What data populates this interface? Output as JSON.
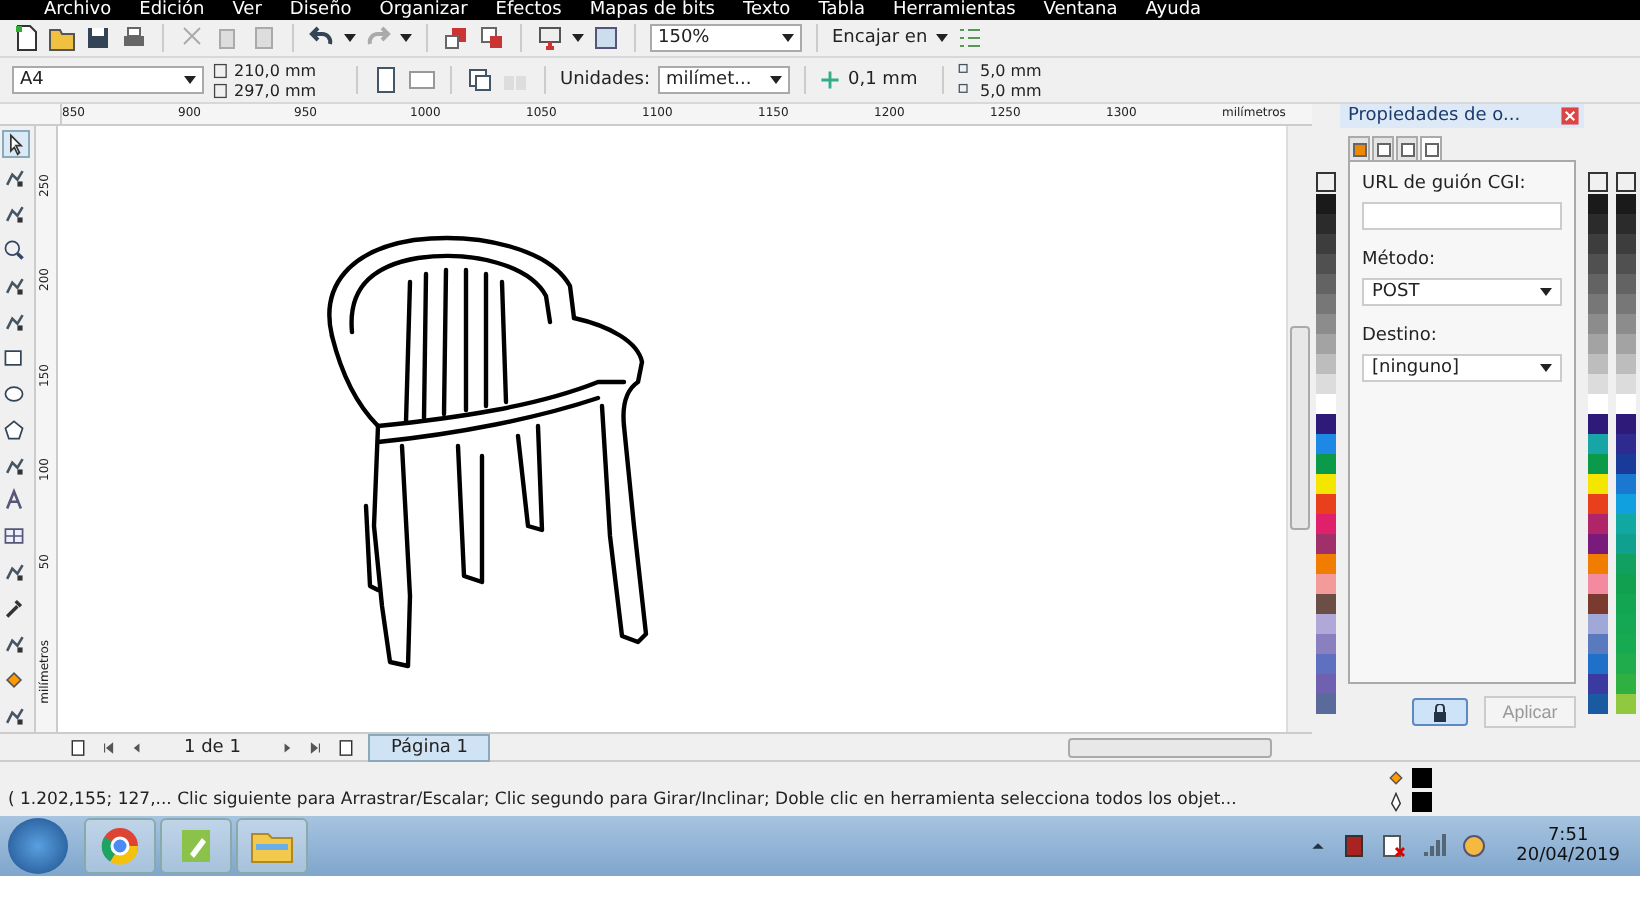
{
  "menu_bar": [
    "Archivo",
    "Edición",
    "Ver",
    "Diseño",
    "Organizar",
    "Efectos",
    "Mapas de bits",
    "Texto",
    "Tabla",
    "Herramientas",
    "Ventana",
    "Ayuda"
  ],
  "standard_toolbar": {
    "zoom": "150%",
    "snap": "Encajar en"
  },
  "property_bar": {
    "page_size": "A4",
    "width": "210,0 mm",
    "height": "297,0 mm",
    "units_label": "Unidades:",
    "units": "milímet...",
    "nudge": "0,1 mm",
    "duplicate_x": "5,0 mm",
    "duplicate_y": "5,0 mm"
  },
  "horizontal_ruler": {
    "ticks": [
      "850",
      "900",
      "950",
      "1000",
      "1050",
      "1100",
      "1150",
      "1200",
      "1250",
      "1300"
    ],
    "unit": "milímetros"
  },
  "vertical_ruler": {
    "ticks": [
      "250",
      "200",
      "150",
      "100",
      "50"
    ],
    "unit": "milímetros"
  },
  "page_navigator": {
    "count": "1 de 1",
    "tabs": [
      {
        "label": "Página 1",
        "selected": true
      }
    ]
  },
  "docker": {
    "title": "Propiedades de o...",
    "tabs": [
      {
        "selected": false
      },
      {
        "selected": false
      },
      {
        "selected": false
      },
      {
        "selected": true
      }
    ],
    "fields": [
      {
        "kind": "text",
        "label": "URL de guión CGI:"
      },
      {
        "kind": "select",
        "label": "Método:",
        "value": "POST"
      },
      {
        "kind": "select",
        "label": "Destino:",
        "value": "[ninguno]"
      }
    ],
    "apply": {
      "label": "Aplicar",
      "disabled": true
    }
  },
  "palettes": [
    {
      "swatches": [
        {
          "color": "#1a1a1a"
        },
        {
          "color": "#2b2b2b"
        },
        {
          "color": "#3d3d3d"
        },
        {
          "color": "#505050"
        },
        {
          "color": "#636363"
        },
        {
          "color": "#777777"
        },
        {
          "color": "#8c8c8c"
        },
        {
          "color": "#a3a3a3"
        },
        {
          "color": "#bdbdbd"
        },
        {
          "color": "#dcdcdc"
        },
        {
          "color": "#ffffff"
        },
        {
          "color": "#2e1a78"
        },
        {
          "color": "#1e88e5"
        },
        {
          "color": "#0a9a4a"
        },
        {
          "color": "#f5e600"
        },
        {
          "color": "#e8401c"
        },
        {
          "color": "#e0206a"
        },
        {
          "color": "#a0306a"
        },
        {
          "color": "#f07d00"
        },
        {
          "color": "#f39a9a"
        },
        {
          "color": "#6b4e45"
        },
        {
          "color": "#b0a8d8"
        },
        {
          "color": "#8a80c0"
        },
        {
          "color": "#6070c0"
        },
        {
          "color": "#7060b0"
        },
        {
          "color": "#5a6a9a"
        }
      ]
    },
    {
      "swatches": [
        {
          "color": "#1a1a1a"
        },
        {
          "color": "#2b2b2b"
        },
        {
          "color": "#3d3d3d"
        },
        {
          "color": "#505050"
        },
        {
          "color": "#636363"
        },
        {
          "color": "#777777"
        },
        {
          "color": "#8c8c8c"
        },
        {
          "color": "#a3a3a3"
        },
        {
          "color": "#bdbdbd"
        },
        {
          "color": "#dcdcdc"
        },
        {
          "color": "#ffffff"
        },
        {
          "color": "#2e1a78"
        },
        {
          "color": "#17a5a5"
        },
        {
          "color": "#0a9a4a"
        },
        {
          "color": "#f5e600"
        },
        {
          "color": "#e8401c"
        },
        {
          "color": "#b0246a"
        },
        {
          "color": "#7a1a7a"
        },
        {
          "color": "#f07d00"
        },
        {
          "color": "#f38aa0"
        },
        {
          "color": "#7a3a30"
        },
        {
          "color": "#a0a8d8"
        },
        {
          "color": "#5a7ac0"
        },
        {
          "color": "#1e70c8"
        },
        {
          "color": "#3a3aa0"
        },
        {
          "color": "#1a5aa0"
        }
      ]
    },
    {
      "swatches": [
        {
          "color": "#1a1a1a"
        },
        {
          "color": "#2b2b2b"
        },
        {
          "color": "#3d3d3d"
        },
        {
          "color": "#505050"
        },
        {
          "color": "#636363"
        },
        {
          "color": "#777777"
        },
        {
          "color": "#8c8c8c"
        },
        {
          "color": "#a3a3a3"
        },
        {
          "color": "#bdbdbd"
        },
        {
          "color": "#dcdcdc"
        },
        {
          "color": "#ffffff"
        },
        {
          "color": "#2e1a78"
        },
        {
          "color": "#2e2a90"
        },
        {
          "color": "#1a3a9a"
        },
        {
          "color": "#1a78d0"
        },
        {
          "color": "#10a0e0"
        },
        {
          "color": "#10a8a0"
        },
        {
          "color": "#10a090"
        },
        {
          "color": "#10a060"
        },
        {
          "color": "#10a050"
        },
        {
          "color": "#12a552"
        },
        {
          "color": "#14a854"
        },
        {
          "color": "#18aa50"
        },
        {
          "color": "#20ac4c"
        },
        {
          "color": "#30b040"
        },
        {
          "color": "#90c840"
        }
      ]
    }
  ],
  "status_bar": {
    "text": "( 1.202,155; 127,... Clic siguiente para Arrastrar/Escalar; Clic segundo para Girar/Inclinar; Doble clic en herramienta selecciona todos los objet..."
  },
  "taskbar": {
    "time": "7:51",
    "date": "20/04/2019"
  }
}
